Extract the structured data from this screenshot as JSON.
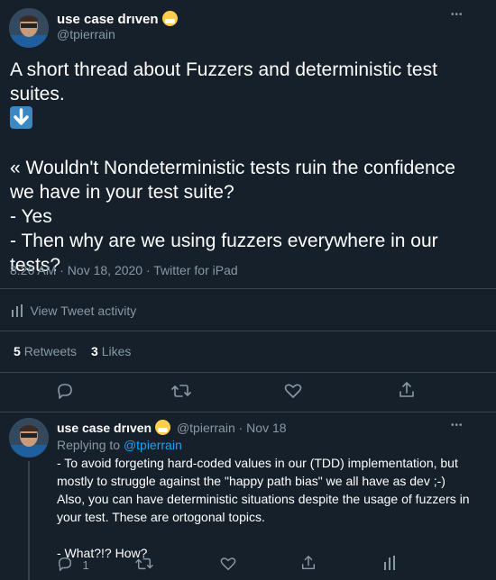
{
  "tweet": {
    "author_name": "use case drıven",
    "handle": "@tpierrain",
    "paragraph1": "A short thread about Fuzzers and deterministic test suites.",
    "line_q": "« Wouldn't Nondeterministic tests ruin the confidence we have in your test suite?",
    "line_yes": "- Yes",
    "line_then": "- Then why are we using fuzzers everywhere in our tests?",
    "meta": "8:26 AM · Nov 18, 2020 · Twitter for iPad",
    "activity": "View Tweet activity",
    "retweets_count": "5",
    "retweets_label": "Retweets",
    "likes_count": "3",
    "likes_label": "Likes"
  },
  "reply": {
    "author_name": "use case drıven",
    "handle_date": "@tpierrain · Nov 18",
    "replying_prefix": "Replying to",
    "replying_to": "@tpierrain",
    "line1": "- To avoid forgeting hard-coded values in our (TDD) implementation, but",
    "line2": "mostly to struggle against the \"happy path bias\" we all have as dev ;-)",
    "line3": "Also, you can have deterministic situations despite the usage of fuzzers in",
    "line4": "your test. These are ortogonal topics.",
    "line5": "- What?!? How?",
    "reply_count": "1"
  },
  "colors": {
    "background": "#15202b",
    "muted": "#8899a6",
    "link": "#1da1f2",
    "divider": "#38444d"
  }
}
